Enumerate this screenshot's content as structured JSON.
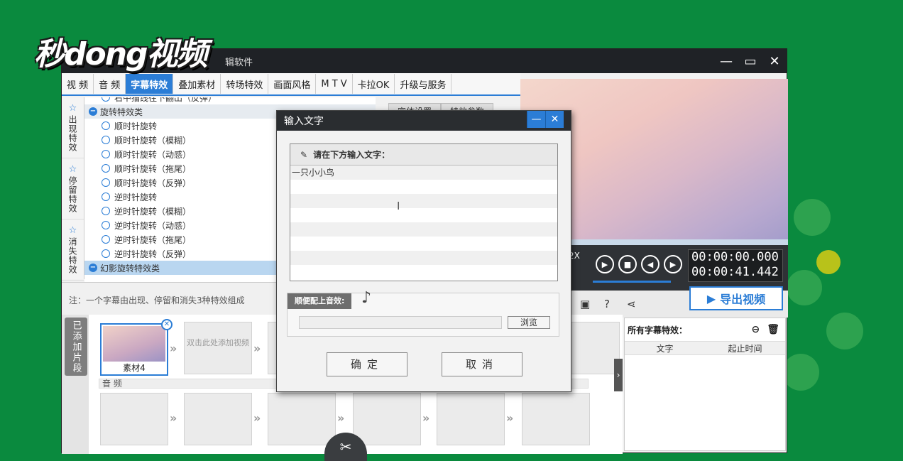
{
  "logo": "秒dong视频",
  "window": {
    "title_suffix": "辑软件",
    "controls": [
      "—",
      "▭",
      "✕"
    ]
  },
  "tabs": [
    {
      "label": "视  频",
      "active": false
    },
    {
      "label": "音  频",
      "active": false
    },
    {
      "label": "字幕特效",
      "active": true
    },
    {
      "label": "叠加素材",
      "active": false
    },
    {
      "label": "转场特效",
      "active": false
    },
    {
      "label": "画面风格",
      "active": false
    },
    {
      "label": "M T V",
      "active": false
    },
    {
      "label": "卡拉OK",
      "active": false
    },
    {
      "label": "升级与服务",
      "active": false
    }
  ],
  "side_tabs": [
    {
      "label": "出现特效"
    },
    {
      "label": "停留特效"
    },
    {
      "label": "消失特效"
    }
  ],
  "effects": {
    "partial_top": "右中描线往下翻出（反弹）",
    "category1": "旋转特效类",
    "items": [
      "顺时针旋转",
      "顺时针旋转（模糊）",
      "顺时针旋转（动感）",
      "顺时针旋转（拖尾）",
      "顺时针旋转（反弹）",
      "逆时针旋转",
      "逆时针旋转（模糊）",
      "逆时针旋转（动感）",
      "逆时针旋转（拖尾）",
      "逆时针旋转（反弹）"
    ],
    "category2": "幻影旋转特效类"
  },
  "param_tabs": [
    "字体设置",
    "特效参数"
  ],
  "note": "注：一个字幕由出现、停留和消失3种特效组成",
  "player": {
    "speed": "2X",
    "time_current": "00:00:00.000",
    "time_total": "00:00:41.442"
  },
  "export_label": "导出视频",
  "timeline": {
    "label": "已添加片段",
    "clip1": "素材4",
    "hint": "双击此处添加视频",
    "audio_label": "音 频"
  },
  "subs_panel": {
    "title": "所有字幕特效：",
    "col_text": "文字",
    "col_time": "起止时间"
  },
  "dialog": {
    "title": "输入文字",
    "prompt": "请在下方输入文字：",
    "text_value": "一只小小鸟",
    "music_label": "顺便配上音效:",
    "browse": "浏览",
    "ok": "确定",
    "cancel": "取消"
  },
  "colors": {
    "accent": "#2b7dd6",
    "background": "#0a8a3e",
    "titlebar": "#1f2226"
  }
}
